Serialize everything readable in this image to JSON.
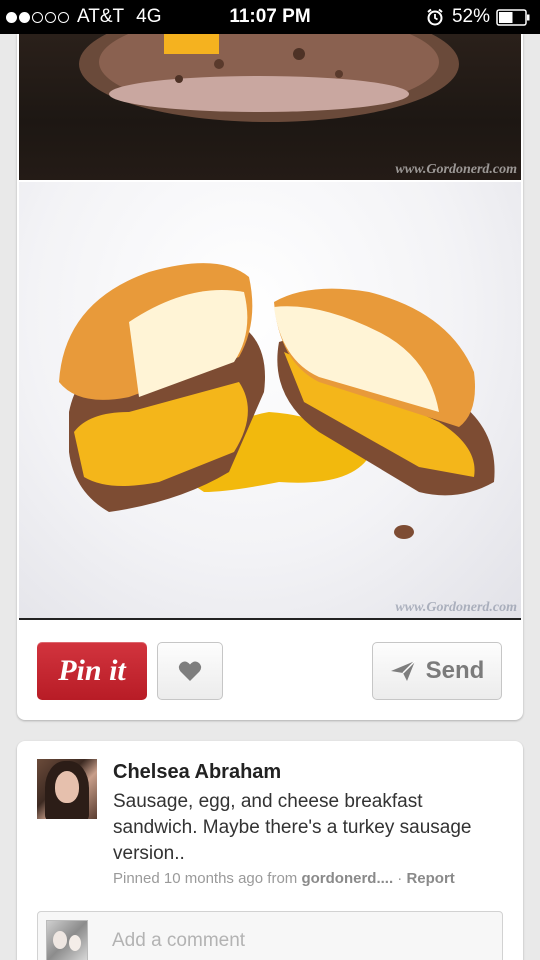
{
  "status_bar": {
    "carrier": "AT&T",
    "network": "4G",
    "time": "11:07 PM",
    "battery_percent": "52%",
    "signal_bars_filled": 2,
    "signal_bars_total": 5,
    "battery_level": 0.52
  },
  "pin": {
    "watermark_top": "www.Gordonerd.com",
    "watermark_bottom": "www.Gordonerd.com",
    "pin_it_label": "Pin it",
    "send_label": "Send",
    "icons": {
      "like": "heart-icon",
      "send": "paper-plane-icon"
    }
  },
  "details": {
    "user_name": "Chelsea Abraham",
    "description": "Sausage, egg, and cheese breakfast sandwich. Maybe there's a turkey sausage version..",
    "pinned_text": "Pinned 10 months ago from ",
    "source": "gordonerd....",
    "separator": " · ",
    "report_label": "Report",
    "comment_placeholder": "Add a comment"
  },
  "colors": {
    "pinterest_red": "#c8232c",
    "background": "#e9e9e9"
  }
}
